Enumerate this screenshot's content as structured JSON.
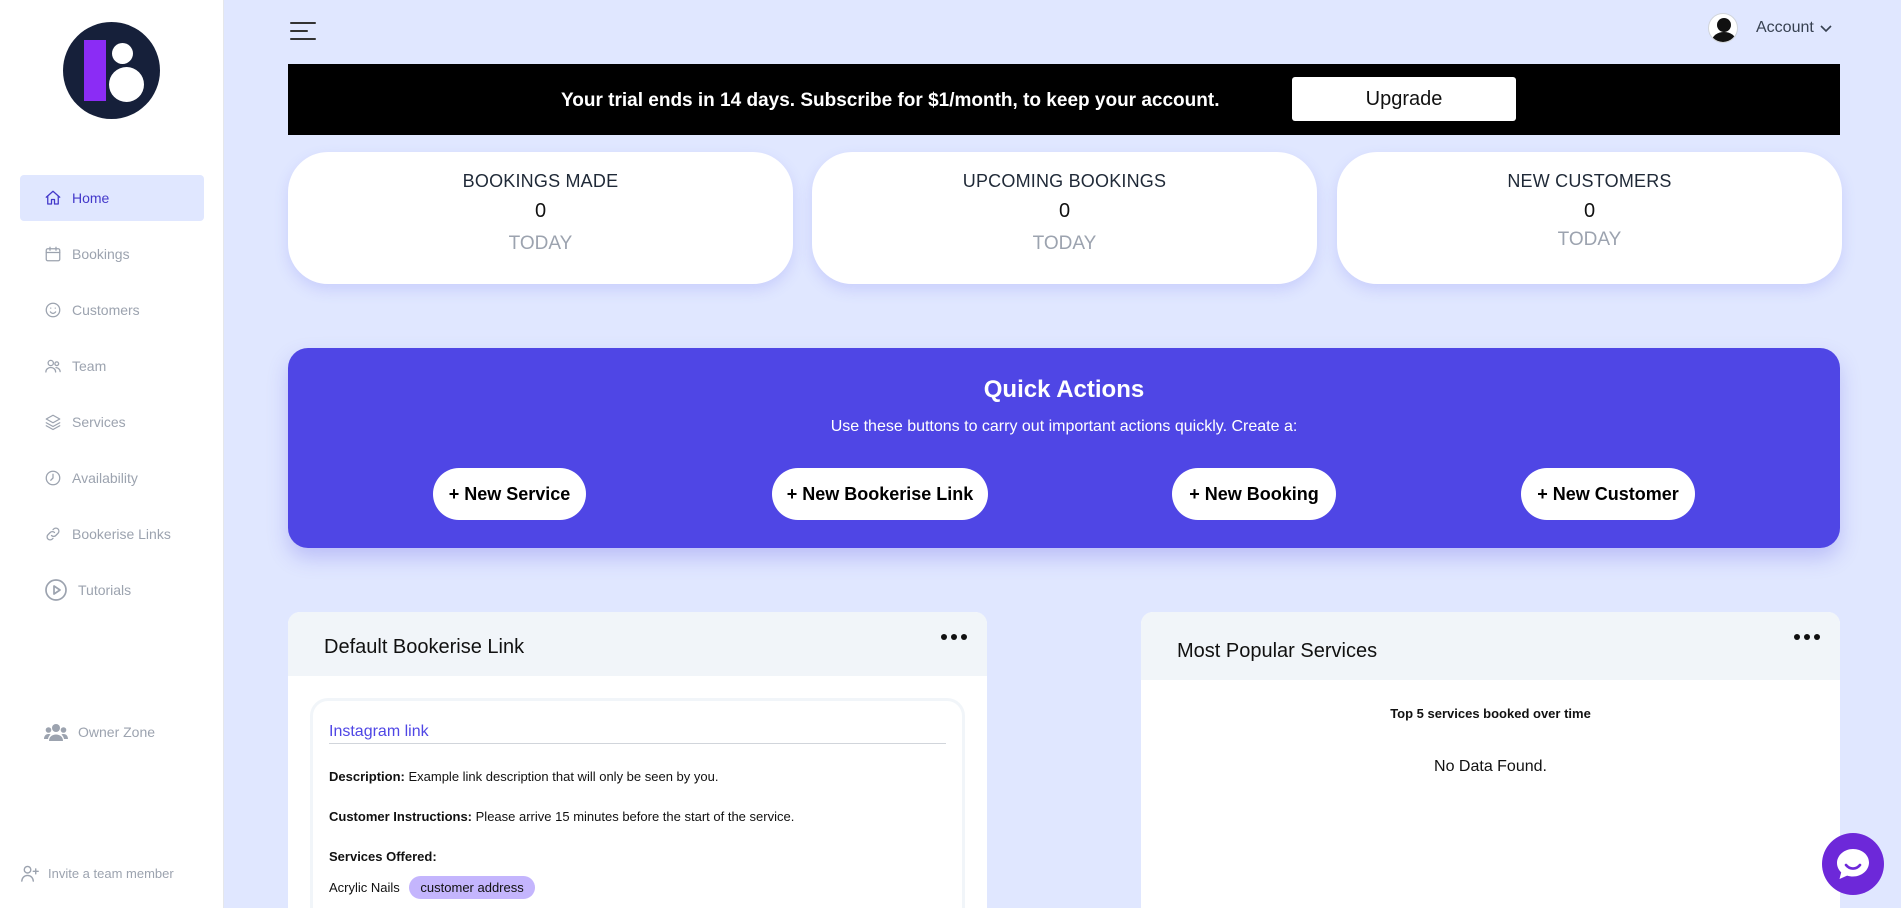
{
  "sidebar": {
    "items": [
      {
        "label": "Home",
        "icon": "home-icon",
        "active": true
      },
      {
        "label": "Bookings",
        "icon": "calendar-icon"
      },
      {
        "label": "Customers",
        "icon": "smiley-icon"
      },
      {
        "label": "Team",
        "icon": "users-icon"
      },
      {
        "label": "Services",
        "icon": "layers-icon"
      },
      {
        "label": "Availability",
        "icon": "clock-icon"
      },
      {
        "label": "Bookerise Links",
        "icon": "link-icon"
      },
      {
        "label": "Tutorials",
        "icon": "play-icon"
      }
    ],
    "owner_zone": "Owner Zone",
    "invite": "Invite a team member"
  },
  "header": {
    "account_label": "Account"
  },
  "trial": {
    "text": "Your trial ends in 14 days. Subscribe for $1/month, to keep your account.",
    "button": "Upgrade"
  },
  "stats": [
    {
      "title": "BOOKINGS MADE",
      "value": "0",
      "period": "TODAY"
    },
    {
      "title": "UPCOMING BOOKINGS",
      "value": "0",
      "period": "TODAY"
    },
    {
      "title": "NEW CUSTOMERS",
      "value": "0",
      "period": "TODAY"
    }
  ],
  "quick_actions": {
    "title": "Quick Actions",
    "subtitle": "Use these buttons to carry out important actions quickly. Create a:",
    "buttons": [
      "+ New Service",
      "+ New Bookerise Link",
      "+ New Booking",
      "+ New Customer"
    ]
  },
  "default_link": {
    "title": "Default Bookerise Link",
    "name": "Instagram link",
    "description_label": "Description:",
    "description": "Example link description that will only be seen by you.",
    "instructions_label": "Customer Instructions:",
    "instructions": "Please arrive 15 minutes before the start of the service.",
    "services_label": "Services Offered:",
    "service": "Acrylic Nails",
    "service_tag": "customer address"
  },
  "popular": {
    "title": "Most Popular Services",
    "subtitle": "Top 5 services booked over time",
    "empty": "No Data Found."
  },
  "colors": {
    "page_bg": "#e0e7ff",
    "accent": "#4f46e5",
    "brand_purple": "#8b2cf5",
    "chat": "#6d28d9"
  }
}
